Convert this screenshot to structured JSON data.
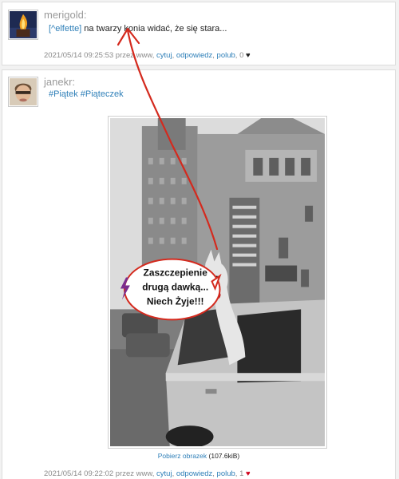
{
  "posts": [
    {
      "username": "merigold:",
      "reply_tag": "[^elfette]",
      "text": " na twarzy konia widać, że się stara...",
      "meta_prefix": "2021/05/14 09:25:53 przez www, ",
      "actions": [
        "cytuj",
        "odpowiedz",
        "polub"
      ],
      "likes": "0"
    },
    {
      "username": "janekr:",
      "tags": [
        "#Piątek",
        "#Piąteczek"
      ],
      "image_caption": [
        "Zaszczepienie",
        "drugą dawką...",
        "Niech Żyje!!!"
      ],
      "download_label": "Pobierz obrazek",
      "download_size": " (107.6kiB)",
      "meta_prefix": "2021/05/14 09:22:02 przez www, ",
      "actions": [
        "cytuj",
        "odpowiedz",
        "polub"
      ],
      "likes": "1"
    }
  ],
  "colors": {
    "link": "#2e7fb8",
    "annotation": "#d42a1e",
    "lightning": "#7b2d8e"
  },
  "icons": {
    "heart": "heart-icon",
    "lightning": "lightning-icon"
  }
}
